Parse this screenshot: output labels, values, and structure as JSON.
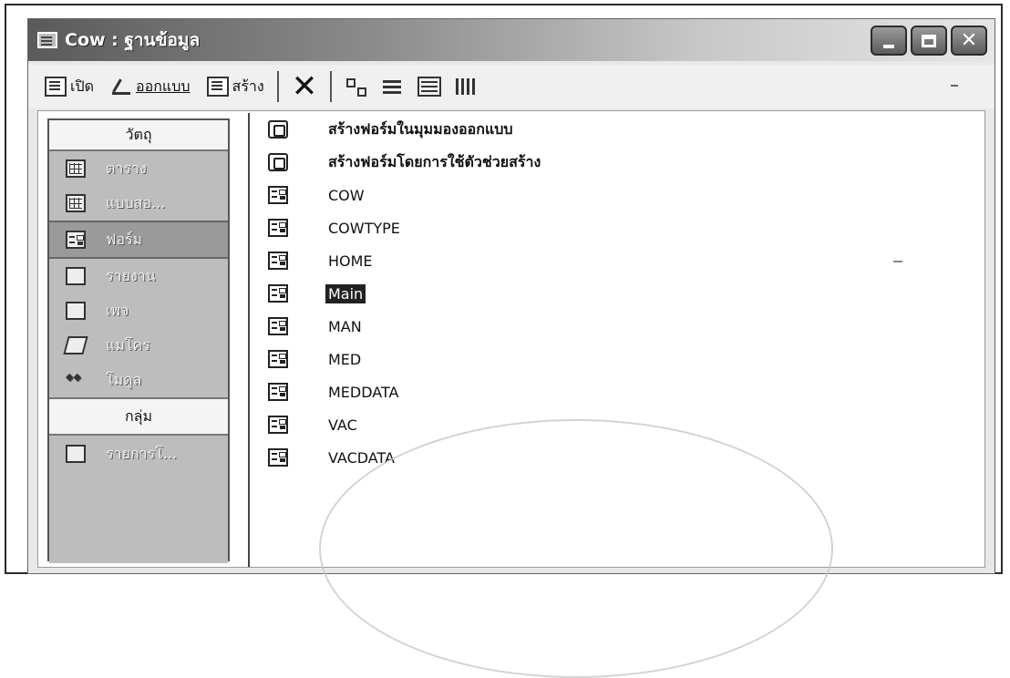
{
  "window": {
    "title": "Cow : ฐานข้อมูล"
  },
  "toolbar": {
    "open_label": "เปิด",
    "design_label": "ออกแบบ",
    "new_label": "สร้าง"
  },
  "sidebar": {
    "objects_header": "วัตถุ",
    "items": [
      {
        "label": "ตาราง",
        "icon": "table-icon"
      },
      {
        "label": "แบบสอ...",
        "icon": "query-icon"
      },
      {
        "label": "ฟอร์ม",
        "icon": "form-icon"
      },
      {
        "label": "รายงาน",
        "icon": "report-icon"
      },
      {
        "label": "เพจ",
        "icon": "page-icon"
      },
      {
        "label": "แมโคร",
        "icon": "macro-icon"
      },
      {
        "label": "โมดูล",
        "icon": "module-icon"
      }
    ],
    "groups_header": "กลุ่ม",
    "group_items": [
      {
        "label": "รายการโ...",
        "icon": "favorites-icon"
      }
    ]
  },
  "list": {
    "items": [
      {
        "label": "สร้างฟอร์มในมุมมองออกแบบ",
        "kind": "wizard"
      },
      {
        "label": "สร้างฟอร์มโดยการใช้ตัวช่วยสร้าง",
        "kind": "wizard"
      },
      {
        "label": "COW",
        "kind": "form"
      },
      {
        "label": "COWTYPE",
        "kind": "form"
      },
      {
        "label": "HOME",
        "kind": "form"
      },
      {
        "label": "Main",
        "kind": "form",
        "selected": true
      },
      {
        "label": "MAN",
        "kind": "form"
      },
      {
        "label": "MED",
        "kind": "form"
      },
      {
        "label": "MEDDATA",
        "kind": "form"
      },
      {
        "label": "VAC",
        "kind": "form"
      },
      {
        "label": "VACDATA",
        "kind": "form"
      }
    ]
  }
}
